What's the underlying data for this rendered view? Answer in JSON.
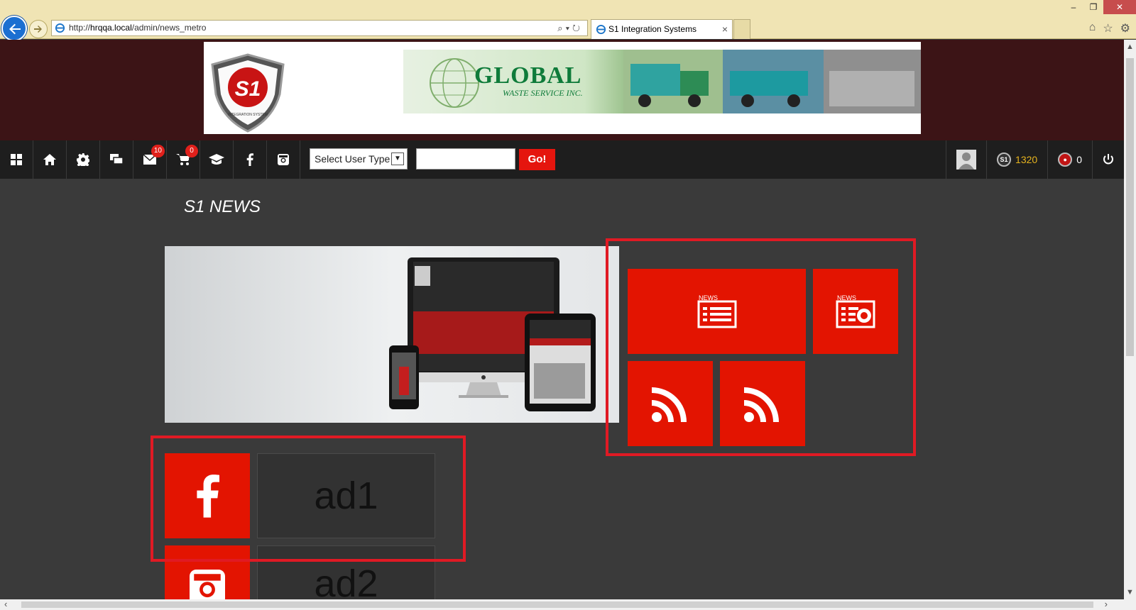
{
  "browser": {
    "url_prefix": "http://",
    "url_host": "hrqqa.local",
    "url_path": "/admin/news_metro",
    "tab_title": "S1 Integration Systems"
  },
  "banner": {
    "logo_text": "S1",
    "logo_subtext": "INTEGRATION SYSTEM",
    "ad_title": "GLOBAL",
    "ad_subtitle": "WASTE SERVICE INC."
  },
  "nav": {
    "messages_count": "10",
    "cart_count": "0",
    "user_type_placeholder": "Select User Type",
    "search_value": "",
    "go_label": "Go!",
    "points": "1320",
    "tokens": "0"
  },
  "page": {
    "title": "S1 NEWS"
  },
  "tiles": {
    "news_label_1": "NEWS",
    "news_label_2": "NEWS",
    "ad1": "ad1",
    "ad2": "ad2"
  },
  "colors": {
    "accent": "#e31401",
    "highlight": "#e01a24",
    "banner_bg": "#3c1416",
    "nav_bg": "#1e1e1e",
    "page_bg": "#3a3a3a",
    "points": "#e6b31e"
  }
}
